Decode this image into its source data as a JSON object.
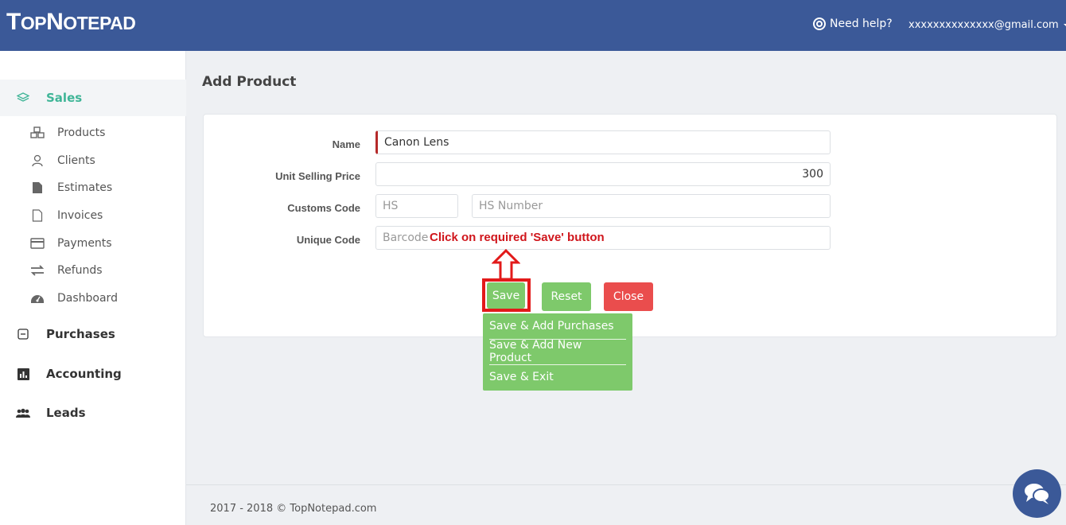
{
  "header": {
    "logo_part1": "T",
    "logo_part2": "OP",
    "logo_part3": "N",
    "logo_part4": "OTEPAD",
    "help_label": "Need help?",
    "user_email": "xxxxxxxxxxxxxx@gmail.com"
  },
  "sidebar": {
    "sections": [
      {
        "label": "Sales",
        "icon": "layers-icon",
        "active": true
      },
      {
        "label": "Purchases",
        "icon": "minus-square-icon"
      },
      {
        "label": "Accounting",
        "icon": "bar-chart-icon"
      },
      {
        "label": "Leads",
        "icon": "users-icon"
      }
    ],
    "sales_items": [
      {
        "label": "Products",
        "icon": "cubes-icon"
      },
      {
        "label": "Clients",
        "icon": "user-icon"
      },
      {
        "label": "Estimates",
        "icon": "file-icon"
      },
      {
        "label": "Invoices",
        "icon": "file-outline-icon"
      },
      {
        "label": "Payments",
        "icon": "credit-card-icon"
      },
      {
        "label": "Refunds",
        "icon": "exchange-icon"
      },
      {
        "label": "Dashboard",
        "icon": "dashboard-icon"
      }
    ]
  },
  "main": {
    "title": "Add Product",
    "form": {
      "name_label": "Name",
      "name_value": "Canon Lens",
      "price_label": "Unit Selling Price",
      "price_value": "300",
      "customs_label": "Customs Code",
      "hs_placeholder": "HS",
      "hs_number_placeholder": "HS Number",
      "unique_label": "Unique Code",
      "barcode_placeholder": "Barcode"
    },
    "annotation": "Click on required 'Save' button",
    "buttons": {
      "save": "Save",
      "reset": "Reset",
      "close": "Close"
    },
    "save_menu": [
      "Save & Add Purchases",
      "Save & Add New Product",
      "Save & Exit"
    ]
  },
  "footer": {
    "text": "2017 - 2018 © TopNotepad.com"
  },
  "colors": {
    "brand": "#3b5998",
    "active": "#3fb597",
    "success": "#7ec96b",
    "danger": "#ea4d4d",
    "annotation": "#d0161c"
  }
}
